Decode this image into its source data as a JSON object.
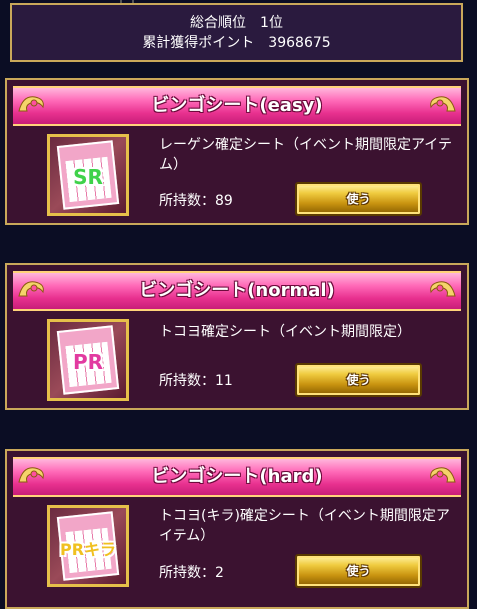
{
  "summary": {
    "rank_line": "総合順位　1位",
    "points_line": "累計獲得ポイント　3968675"
  },
  "cards": [
    {
      "title": "ビンゴシート(easy)",
      "description": "レーゲン確定シート（イベント期間限定アイテム）",
      "owned": "所持数：89",
      "button": "使う",
      "badge": "SR",
      "badge_color": "#3fd24a"
    },
    {
      "title": "ビンゴシート(normal)",
      "description": "トコヨ確定シート（イベント期間限定）",
      "owned": "所持数：11",
      "button": "使う",
      "badge": "PR",
      "badge_color": "#e23aa0"
    },
    {
      "title": "ビンゴシート(hard)",
      "description": "トコヨ(キラ)確定シート（イベント期間限定アイテム）",
      "owned": "所持数：2",
      "button": "使う",
      "badge": "PRキラ",
      "badge_color": "#f0c020"
    }
  ],
  "colors": {
    "background": "#0b0d24",
    "panel": "#3b1230",
    "header_pink": "#e8318f",
    "gold_border": "#c9a85a",
    "button_gold": "#f0cc40"
  }
}
